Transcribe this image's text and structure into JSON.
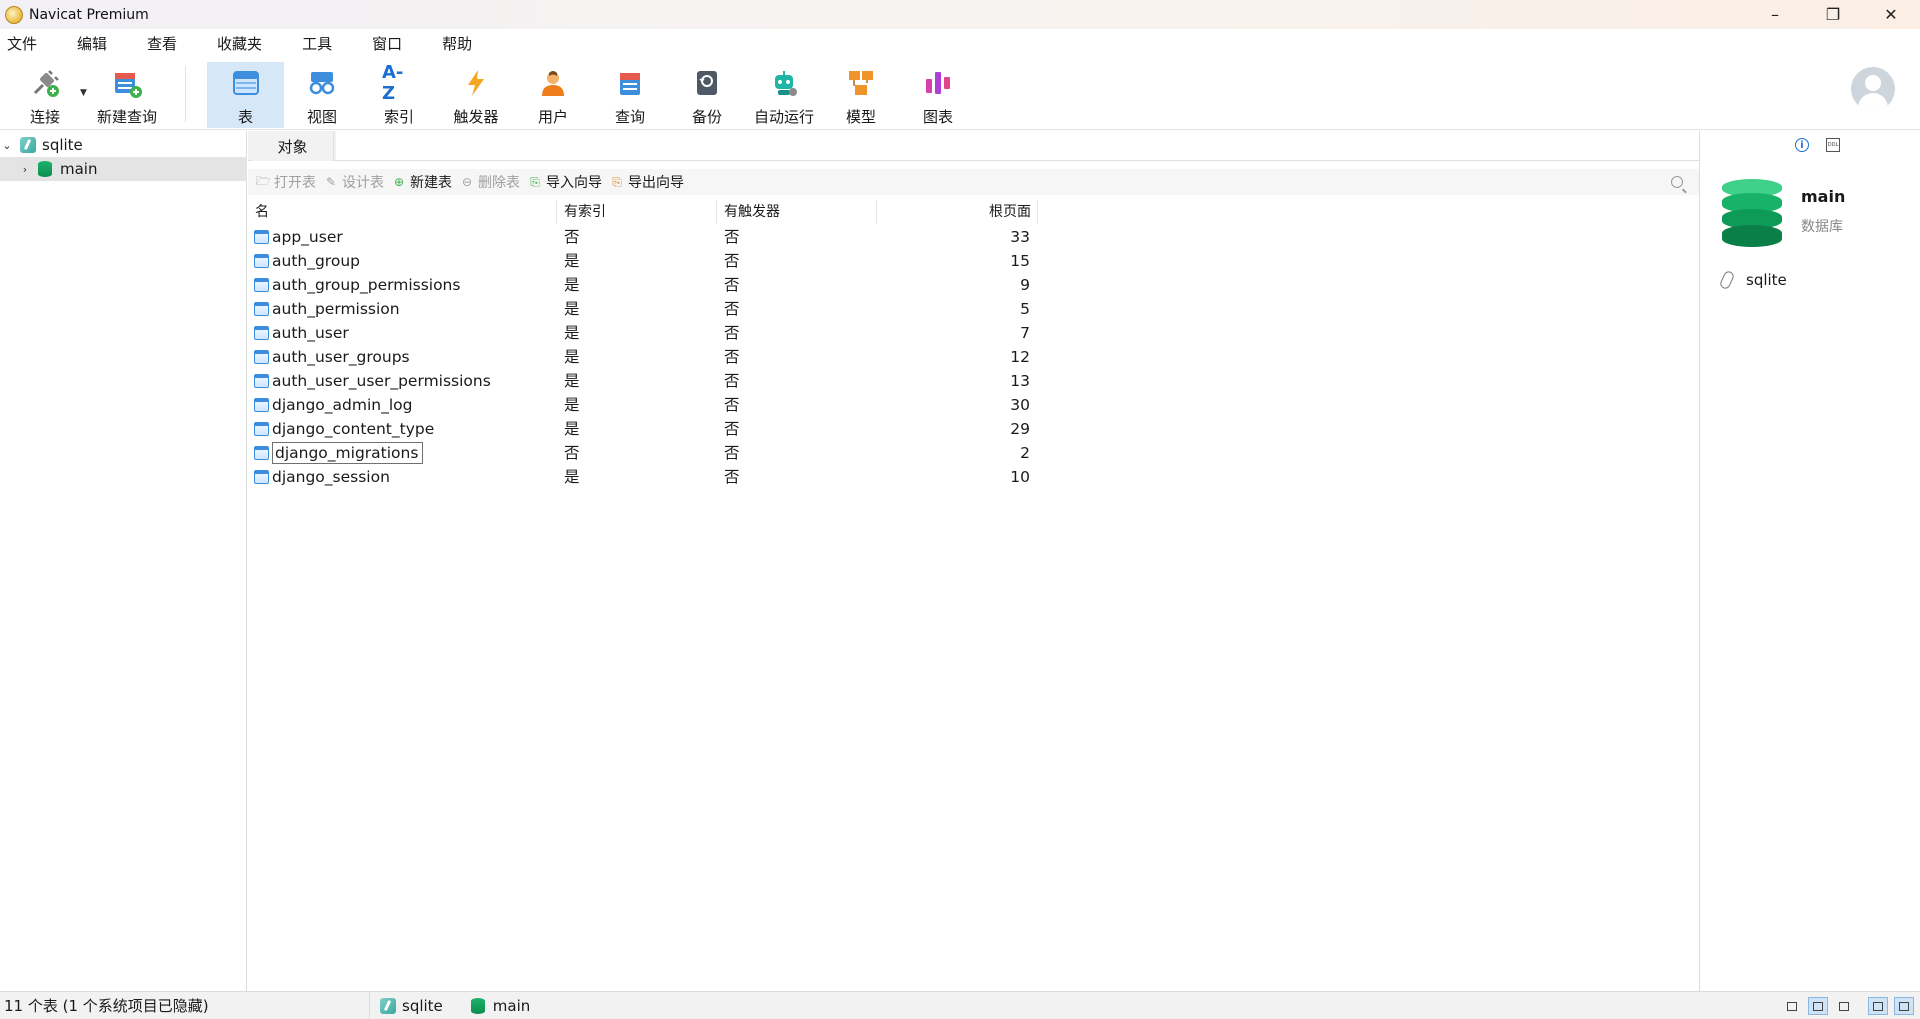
{
  "window": {
    "title": "Navicat Premium",
    "minimize": "–",
    "restore": "❐",
    "close": "✕"
  },
  "menu": [
    "文件",
    "编辑",
    "查看",
    "收藏夹",
    "工具",
    "窗口",
    "帮助"
  ],
  "toolbar": {
    "connect": "连接",
    "new_query": "新建查询",
    "table": "表",
    "view": "视图",
    "index": "索引",
    "index_glyph": "A-Z",
    "trigger": "触发器",
    "user": "用户",
    "query": "查询",
    "backup": "备份",
    "automation": "自动运行",
    "model": "模型",
    "chart": "图表"
  },
  "colors": {
    "accent": "#1b6fd1",
    "active_tool_bg": "#d6e8f7",
    "db_green": "#0c8d50"
  },
  "tree": {
    "connection": "sqlite",
    "database": "main"
  },
  "tabs": {
    "objects": "对象"
  },
  "objbar": {
    "open_table": "打开表",
    "design_table": "设计表",
    "new_table": "新建表",
    "delete_table": "删除表",
    "import_wizard": "导入向导",
    "export_wizard": "导出向导"
  },
  "table": {
    "headers": [
      "名",
      "有索引",
      "有触发器",
      "根页面"
    ],
    "rows": [
      {
        "name": "app_user",
        "has_index": "否",
        "has_trigger": "否",
        "root_page": "33"
      },
      {
        "name": "auth_group",
        "has_index": "是",
        "has_trigger": "否",
        "root_page": "15"
      },
      {
        "name": "auth_group_permissions",
        "has_index": "是",
        "has_trigger": "否",
        "root_page": "9"
      },
      {
        "name": "auth_permission",
        "has_index": "是",
        "has_trigger": "否",
        "root_page": "5"
      },
      {
        "name": "auth_user",
        "has_index": "是",
        "has_trigger": "否",
        "root_page": "7"
      },
      {
        "name": "auth_user_groups",
        "has_index": "是",
        "has_trigger": "否",
        "root_page": "12"
      },
      {
        "name": "auth_user_user_permissions",
        "has_index": "是",
        "has_trigger": "否",
        "root_page": "13"
      },
      {
        "name": "django_admin_log",
        "has_index": "是",
        "has_trigger": "否",
        "root_page": "30"
      },
      {
        "name": "django_content_type",
        "has_index": "是",
        "has_trigger": "否",
        "root_page": "29"
      },
      {
        "name": "django_migrations",
        "has_index": "否",
        "has_trigger": "否",
        "root_page": "2"
      },
      {
        "name": "django_session",
        "has_index": "是",
        "has_trigger": "否",
        "root_page": "10"
      }
    ]
  },
  "info_panel": {
    "name": "main",
    "type": "数据库",
    "connection": "sqlite",
    "ddl_label": "DDL"
  },
  "status": {
    "summary": "11 个表 (1 个系统项目已隐藏)",
    "connection": "sqlite",
    "database": "main"
  }
}
